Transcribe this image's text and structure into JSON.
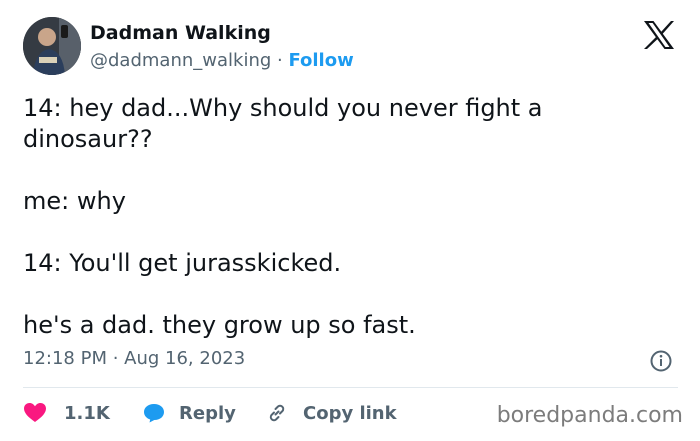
{
  "author": {
    "display_name": "Dadman Walking",
    "handle": "@dadmann_walking",
    "separator": " · ",
    "follow_label": "Follow"
  },
  "tweet": {
    "paragraphs": [
      "14: hey dad...Why should you never fight a dinosaur??",
      "me: why",
      "14: You'll get jurasskicked.",
      "he's a dad. they grow up so fast."
    ],
    "timestamp": "12:18 PM · Aug 16, 2023"
  },
  "actions": {
    "like_count": "1.1K",
    "reply_label": "Reply",
    "copy_link_label": "Copy link"
  },
  "icons": {
    "logo": "x-logo-icon",
    "info": "info-icon",
    "like": "heart-icon",
    "reply": "chat-bubble-icon",
    "copy": "link-icon"
  },
  "colors": {
    "text": "#0f1419",
    "secondary": "#536471",
    "link": "#1d9bf0",
    "heart": "#f91880",
    "reply_bubble": "#1d9bf0",
    "divider": "#e1e8ed"
  },
  "watermark": "boredpanda.com"
}
